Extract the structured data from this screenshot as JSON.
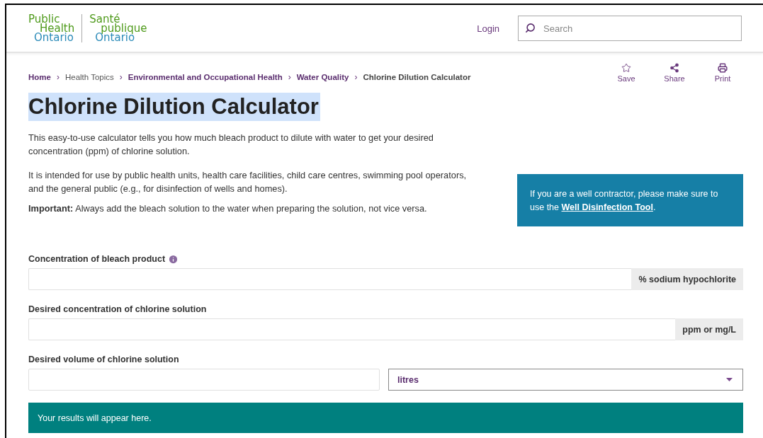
{
  "logo": {
    "english": [
      "Public",
      "Health",
      "Ontario"
    ],
    "french": [
      "Santé",
      "publique",
      "Ontario"
    ]
  },
  "header": {
    "login": "Login",
    "search": {
      "placeholder": "Search"
    }
  },
  "breadcrumb": [
    {
      "label": "Home",
      "kind": "link"
    },
    {
      "label": "Health Topics",
      "kind": "plain"
    },
    {
      "label": "Environmental and Occupational Health",
      "kind": "link"
    },
    {
      "label": "Water Quality",
      "kind": "link"
    },
    {
      "label": "Chlorine Dilution Calculator",
      "kind": "current"
    }
  ],
  "separator": "›",
  "actions": [
    {
      "label": "Save",
      "kind": "star"
    },
    {
      "label": "Share",
      "kind": "share"
    },
    {
      "label": "Print",
      "kind": "print"
    }
  ],
  "title": {
    "text": "Chlorine Dilution Calculator",
    "highlighted": true
  },
  "intro": "This easy-to-use calculator tells you how much bleach product to dilute with water to get your desired concentration (ppm) of chlorine solution.",
  "usage": "It is intended for use by public health units, health care facilities, child care centres, swimming pool operators, and the general public (e.g., for disinfection of wells and homes).",
  "important": "**Important:** Always add the bleach solution to the water when preparing the solution, not vice versa.",
  "callout": {
    "text": "If you are a well contractor, please make sure to use the ",
    "link": "Well Disinfection Tool",
    "end": "."
  },
  "fields": [
    {
      "label": "Concentration of bleach product",
      "kind": "addon_info",
      "unit": "% sodium hypochlorite"
    },
    {
      "label": "Desired concentration of chlorine solution",
      "kind": "addon",
      "unit": "ppm or mg/L"
    },
    {
      "label": "Desired volume of chlorine solution",
      "kind": "select",
      "unit": "litres"
    }
  ],
  "results": "Your results will appear here."
}
